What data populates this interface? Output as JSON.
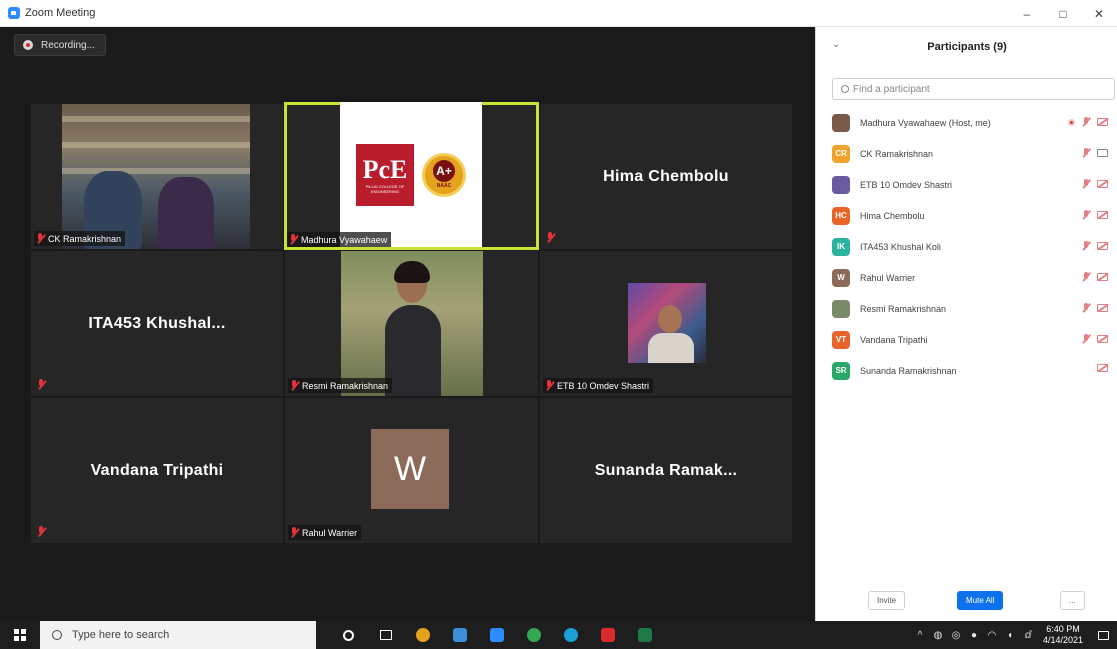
{
  "window": {
    "title": "Zoom Meeting",
    "controls": [
      "–",
      "□",
      "✕"
    ]
  },
  "recording": {
    "label": "Recording..."
  },
  "tiles": {
    "ck": {
      "label": "CK Ramakrishnan"
    },
    "madhura": {
      "label": "Madhura Vyawahaew",
      "logo_text": "PcE",
      "logo_subtext": "PILLAI COLLEGE OF ENGINEERING",
      "badge_grade": "A+",
      "badge_label": "NAAC"
    },
    "hima": {
      "big_name": "Hima Chembolu"
    },
    "khushal": {
      "big_name": "ITA453  Khushal..."
    },
    "resmi": {
      "label": "Resmi Ramakrishnan"
    },
    "omdev": {
      "label": "ETB 10 Omdev Shastri"
    },
    "vandana": {
      "big_name": "Vandana Tripathi"
    },
    "rahul": {
      "label": "Rahul Warrier",
      "avatar_letter": "W"
    },
    "sunanda": {
      "big_name": "Sunanda  Ramak..."
    }
  },
  "panel": {
    "title": "Participants (9)",
    "search_placeholder": "Find a participant",
    "participants": [
      {
        "initials": "",
        "name": "Madhura Vyawahaew (Host, me)",
        "color": "#7a5b4a"
      },
      {
        "initials": "CR",
        "name": "CK Ramakrishnan",
        "color": "#f2a32b"
      },
      {
        "initials": "",
        "name": "ETB 10 Omdev Shastri",
        "color": "#6a5aa0"
      },
      {
        "initials": "HC",
        "name": "Hima Chembolu",
        "color": "#e8652a"
      },
      {
        "initials": "IK",
        "name": "ITA453 Khushal Koli",
        "color": "#2bb3a0"
      },
      {
        "initials": "W",
        "name": "Rahul Warrier",
        "color": "#8b6a5a"
      },
      {
        "initials": "",
        "name": "Resmi Ramakrishnan",
        "color": "#7a8a6a"
      },
      {
        "initials": "VT",
        "name": "Vandana Tripathi",
        "color": "#e8652a"
      },
      {
        "initials": "SR",
        "name": "Sunanda Ramakrishnan",
        "color": "#2aa86a"
      }
    ],
    "invite_label": "Invite",
    "mute_all_label": "Mute All",
    "more_label": "..."
  },
  "taskbar": {
    "search_placeholder": "Type here to search",
    "time": "6:40 PM",
    "date": "4/14/2021",
    "app_colors": [
      "#ffffff",
      "#ffffff",
      "#e4a21d",
      "#3b8ed8",
      "#2d8cff",
      "#34a853",
      "#1a9fd8",
      "#d92d2d",
      "#1e7a44"
    ]
  }
}
